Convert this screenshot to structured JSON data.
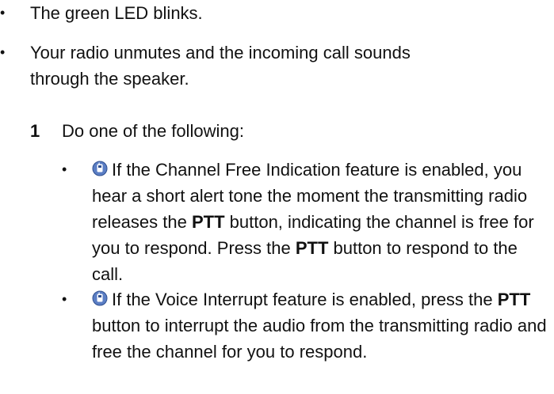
{
  "bullets_top": [
    {
      "marker": "•",
      "text": "The green LED blinks."
    },
    {
      "marker": "•",
      "text": "Your radio unmutes and the incoming call sounds through the speaker."
    }
  ],
  "step": {
    "number": "1",
    "text": "Do one of the following:"
  },
  "sub_bullets": [
    {
      "marker": "•",
      "icon": "radio-feature-icon",
      "part1": "If the Channel Free Indication feature is enabled, you hear a short alert tone the moment the transmitting radio releases the ",
      "bold1": "PTT",
      "part2": " button, indicating the channel is free for you to respond. Press the ",
      "bold2": "PTT",
      "part3": " button to respond to the call."
    },
    {
      "marker": "•",
      "icon": "radio-feature-icon",
      "part1": "If the Voice Interrupt feature is enabled, press the ",
      "bold1": "PTT",
      "part2": " button to interrupt the audio from the transmitting radio and free the channel for you to respond."
    }
  ],
  "colors": {
    "icon_fill": "#5b7ec4",
    "icon_dark": "#2f4f8f",
    "text": "#111111"
  }
}
